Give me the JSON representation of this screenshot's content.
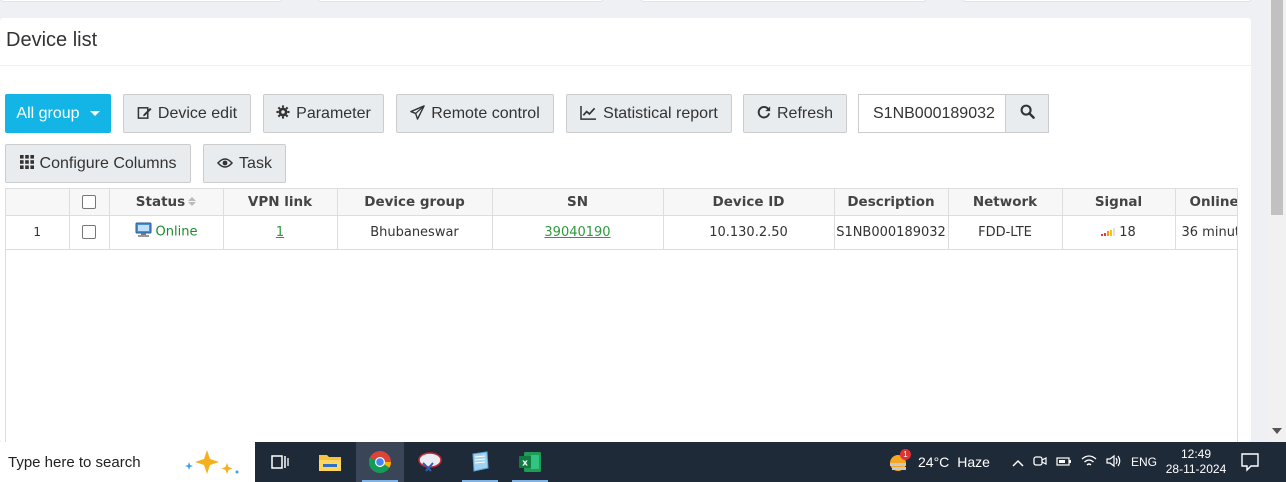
{
  "panel": {
    "title": "Device list"
  },
  "toolbar": {
    "all_group": "All group",
    "device_edit": "Device edit",
    "parameter": "Parameter",
    "remote_control": "Remote control",
    "statistical_report": "Statistical report",
    "refresh": "Refresh",
    "search_value": "S1NB000189032",
    "configure_columns": "Configure Columns",
    "task": "Task"
  },
  "table": {
    "headers": {
      "status": "Status",
      "vpn_link": "VPN link",
      "device_group": "Device group",
      "sn": "SN",
      "device_id": "Device ID",
      "description": "Description",
      "network": "Network",
      "signal": "Signal",
      "online": "Online"
    },
    "rows": [
      {
        "index": "1",
        "status": "Online",
        "vpn_link": "1",
        "device_group": "Bhubaneswar",
        "sn": "39040190",
        "device_id": "10.130.2.50",
        "description": "S1NB000189032",
        "network": "FDD-LTE",
        "signal": "18",
        "online": "36 minut"
      }
    ]
  },
  "taskbar": {
    "search_placeholder": "Type here to search",
    "weather_temp": "24°C",
    "weather_desc": "Haze",
    "weather_badge": "1",
    "language": "ENG",
    "time": "12:49",
    "date": "28-11-2024"
  },
  "colors": {
    "primary": "#12b5e5",
    "online_green": "#1e8a2e",
    "taskbar": "#1f2a38"
  }
}
